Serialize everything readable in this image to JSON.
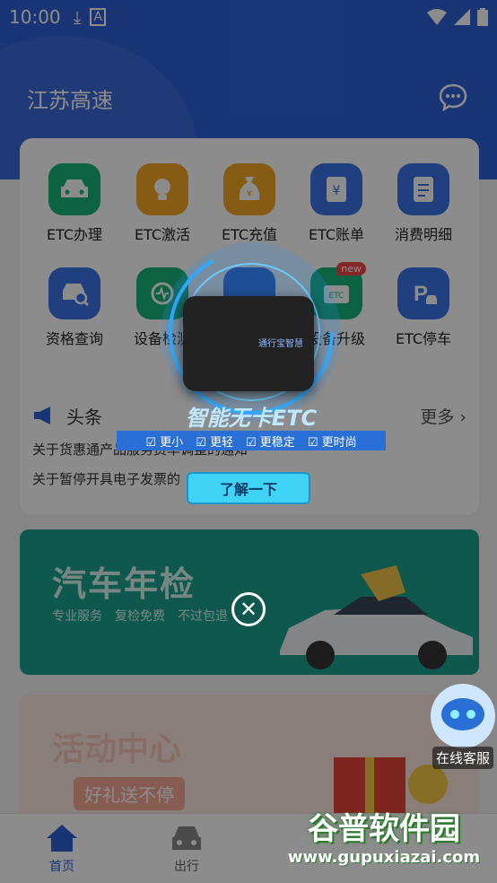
{
  "status": {
    "time": "10:00"
  },
  "header": {
    "title": "江苏高速"
  },
  "grid": [
    {
      "label": "ETC办理",
      "icon": "car-icon",
      "color": "#16b47a"
    },
    {
      "label": "ETC激活",
      "icon": "bulb-icon",
      "color": "#f5a623"
    },
    {
      "label": "ETC充值",
      "icon": "money-bag-icon",
      "color": "#f5a623"
    },
    {
      "label": "ETC账单",
      "icon": "bill-icon",
      "color": "#3a73e8"
    },
    {
      "label": "消费明细",
      "icon": "receipt-icon",
      "color": "#3a73e8"
    },
    {
      "label": "资格查询",
      "icon": "car-search-icon",
      "color": "#3a73e8"
    },
    {
      "label": "设备检测",
      "icon": "device-check-icon",
      "color": "#16b47a"
    },
    {
      "label": "",
      "icon": "upgrade-icon",
      "color": "#3a73e8"
    },
    {
      "label": "设备升级",
      "icon": "etc-device-icon",
      "color": "#16b47a",
      "badge": "new"
    },
    {
      "label": "ETC停车",
      "icon": "parking-icon",
      "color": "#3a73e8"
    }
  ],
  "news": {
    "title": "头条",
    "more": "更多",
    "items": [
      "关于货惠通产品服务费率调整的通知",
      "关于暂停开具电子发票的"
    ]
  },
  "banner1": {
    "title": "汽车年检",
    "tags": [
      "专业服务",
      "复检免费",
      "不过包退"
    ]
  },
  "banner2": {
    "title": "活动中心",
    "tag": "好礼送不停"
  },
  "nav": {
    "home": "首页",
    "trip": "出行"
  },
  "popup": {
    "brand": "通行宝智慧",
    "headline": "智能无卡ETC",
    "features": [
      "更小",
      "更轻",
      "更稳定",
      "更时尚"
    ],
    "button": "了解一下"
  },
  "service": {
    "label": "在线客服"
  },
  "watermark": {
    "line1": "谷普软件园",
    "line2": "www.gupuxiazai.com"
  }
}
